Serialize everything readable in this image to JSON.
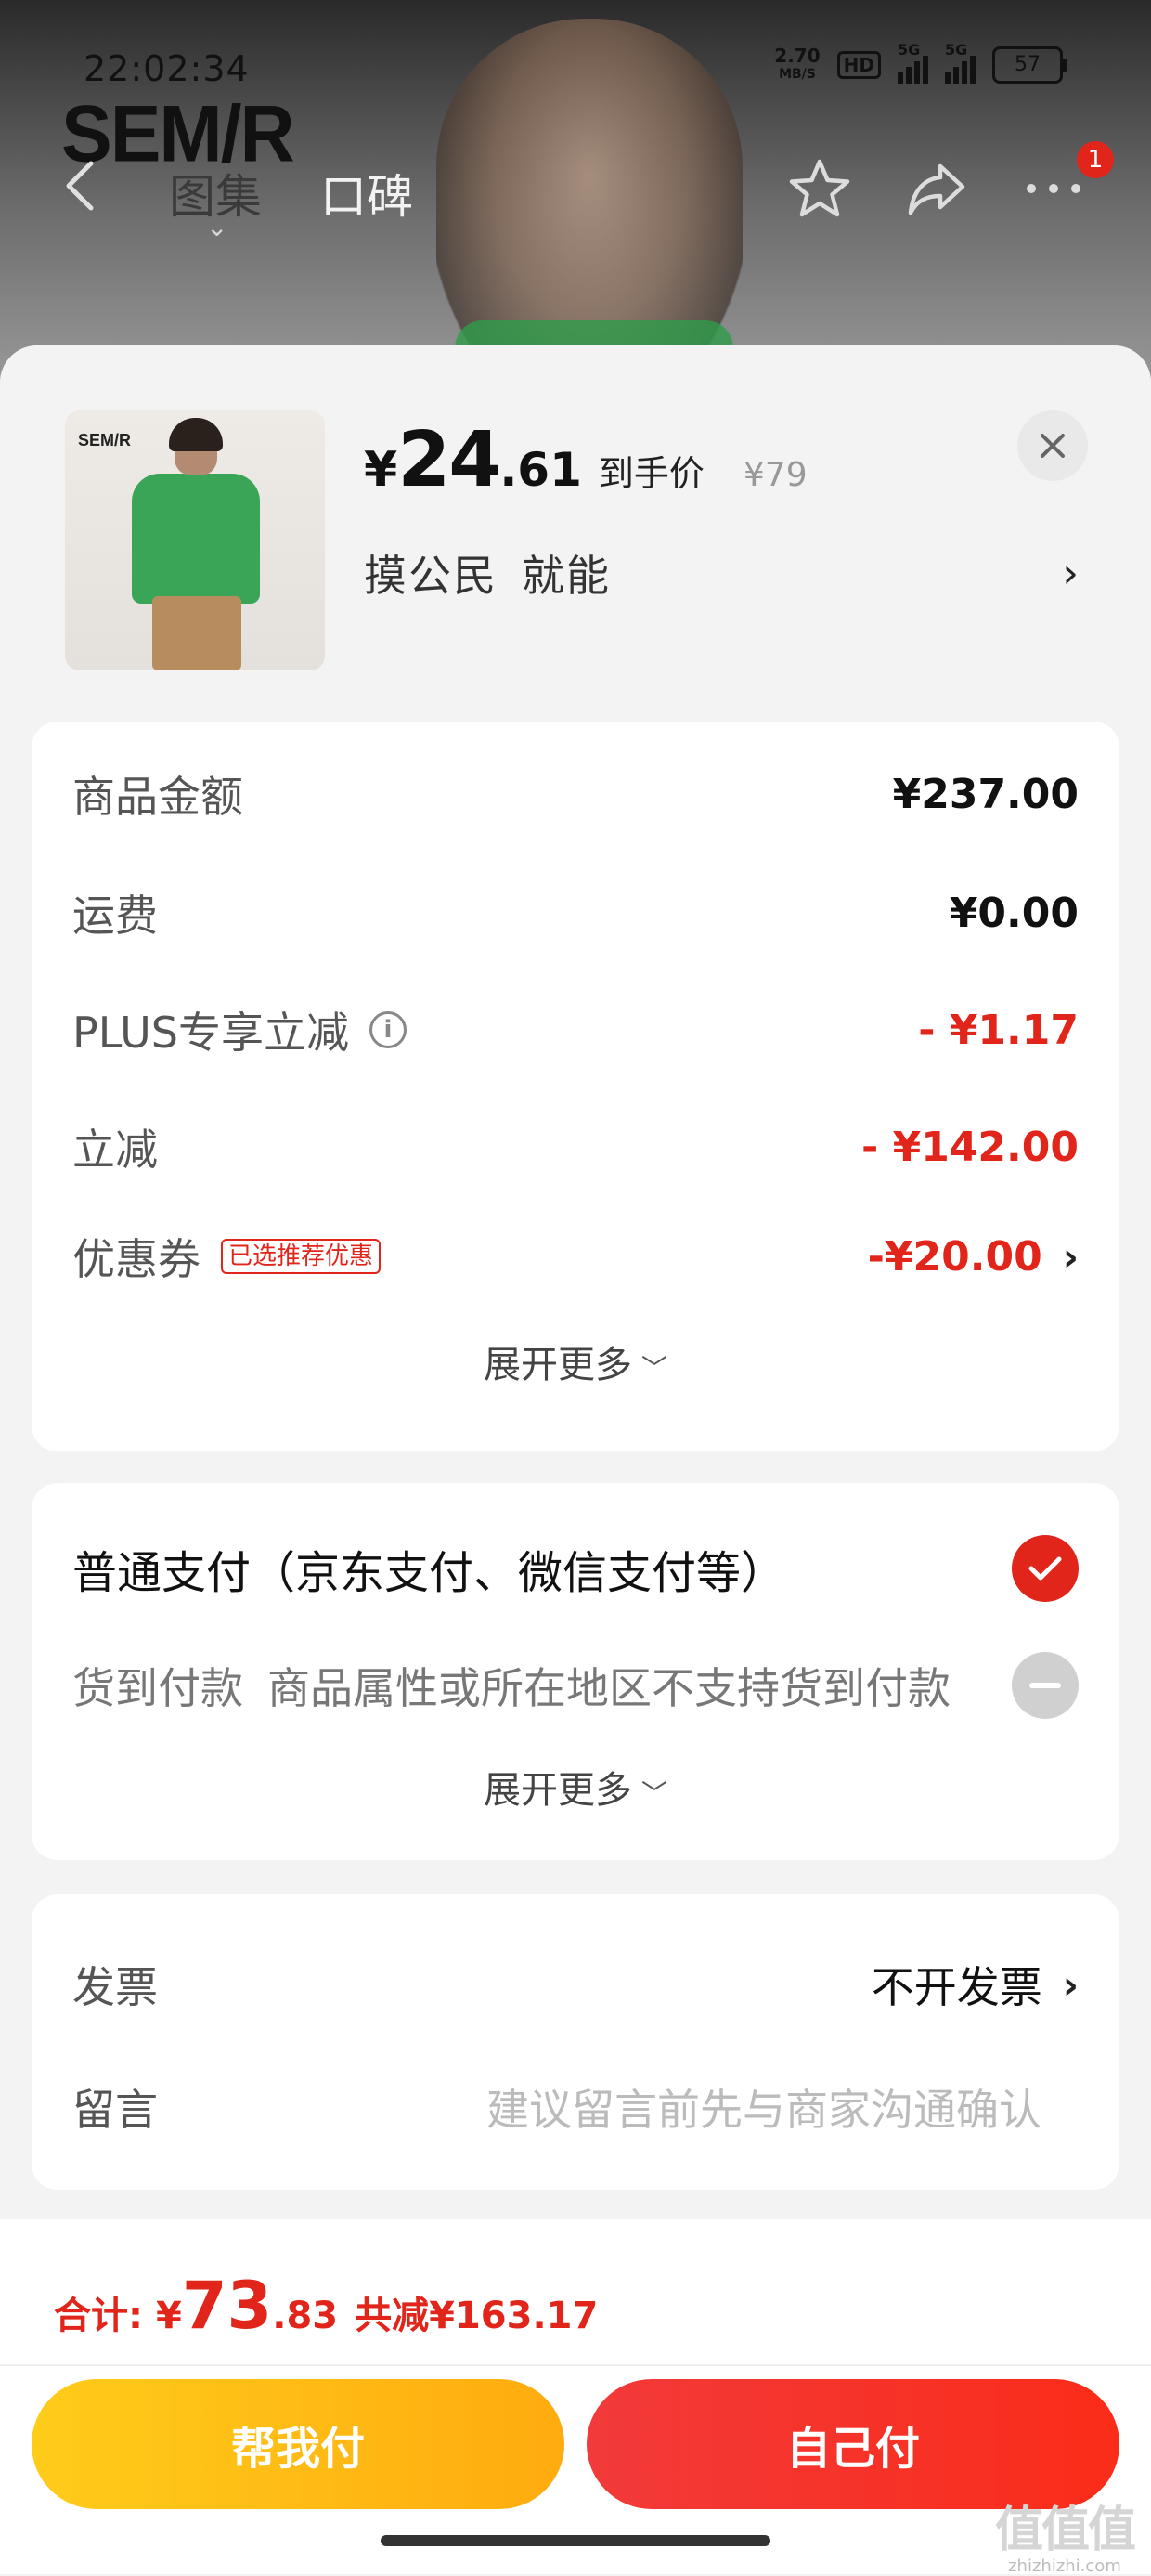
{
  "status_bar": {
    "time": "22:02:34",
    "net_speed_value": "2.70",
    "net_speed_unit": "MB/S",
    "hd": "HD",
    "signal1": "5G",
    "signal2": "5G",
    "battery": "57"
  },
  "nav": {
    "brand": "SEM/R",
    "tabs": [
      {
        "label": "图集"
      },
      {
        "label": "口碑"
      }
    ],
    "more_badge": "1"
  },
  "product": {
    "thumb_brand": "SEM/R",
    "price_symbol": "¥",
    "price_int": "24",
    "price_dec": ".61",
    "price_tag": "到手价",
    "original_price": "¥79",
    "variant_1": "摸公民",
    "variant_2": "就能"
  },
  "summary": {
    "rows": [
      {
        "label": "商品金额",
        "value": "¥237.00"
      },
      {
        "label": "运费",
        "value": "¥0.00"
      },
      {
        "label": "PLUS专享立减",
        "value": "- ¥1.17"
      },
      {
        "label": "立减",
        "value": "- ¥142.00"
      },
      {
        "label": "优惠券",
        "tag": "已选推荐优惠",
        "value": "-¥20.00"
      }
    ],
    "expand": "展开更多"
  },
  "payment": {
    "normal": "普通支付（京东支付、微信支付等）",
    "cod_label": "货到付款",
    "cod_note": "商品属性或所在地区不支持货到付款",
    "expand": "展开更多"
  },
  "extra": {
    "invoice_label": "发票",
    "invoice_value": "不开发票",
    "message_label": "留言",
    "message_placeholder": "建议留言前先与商家沟通确认"
  },
  "footer": {
    "total_label": "合计:",
    "total_symbol": "¥",
    "total_int": "73",
    "total_dec": ".83",
    "saved": "共减¥163.17",
    "help_pay": "帮我付",
    "self_pay": "自己付"
  },
  "watermark": {
    "logo": "值值值",
    "url": "zhizhizhi.com"
  },
  "colors": {
    "accent_red": "#e1251b",
    "help_button": "#ffb812",
    "self_button": "#f5352a"
  }
}
